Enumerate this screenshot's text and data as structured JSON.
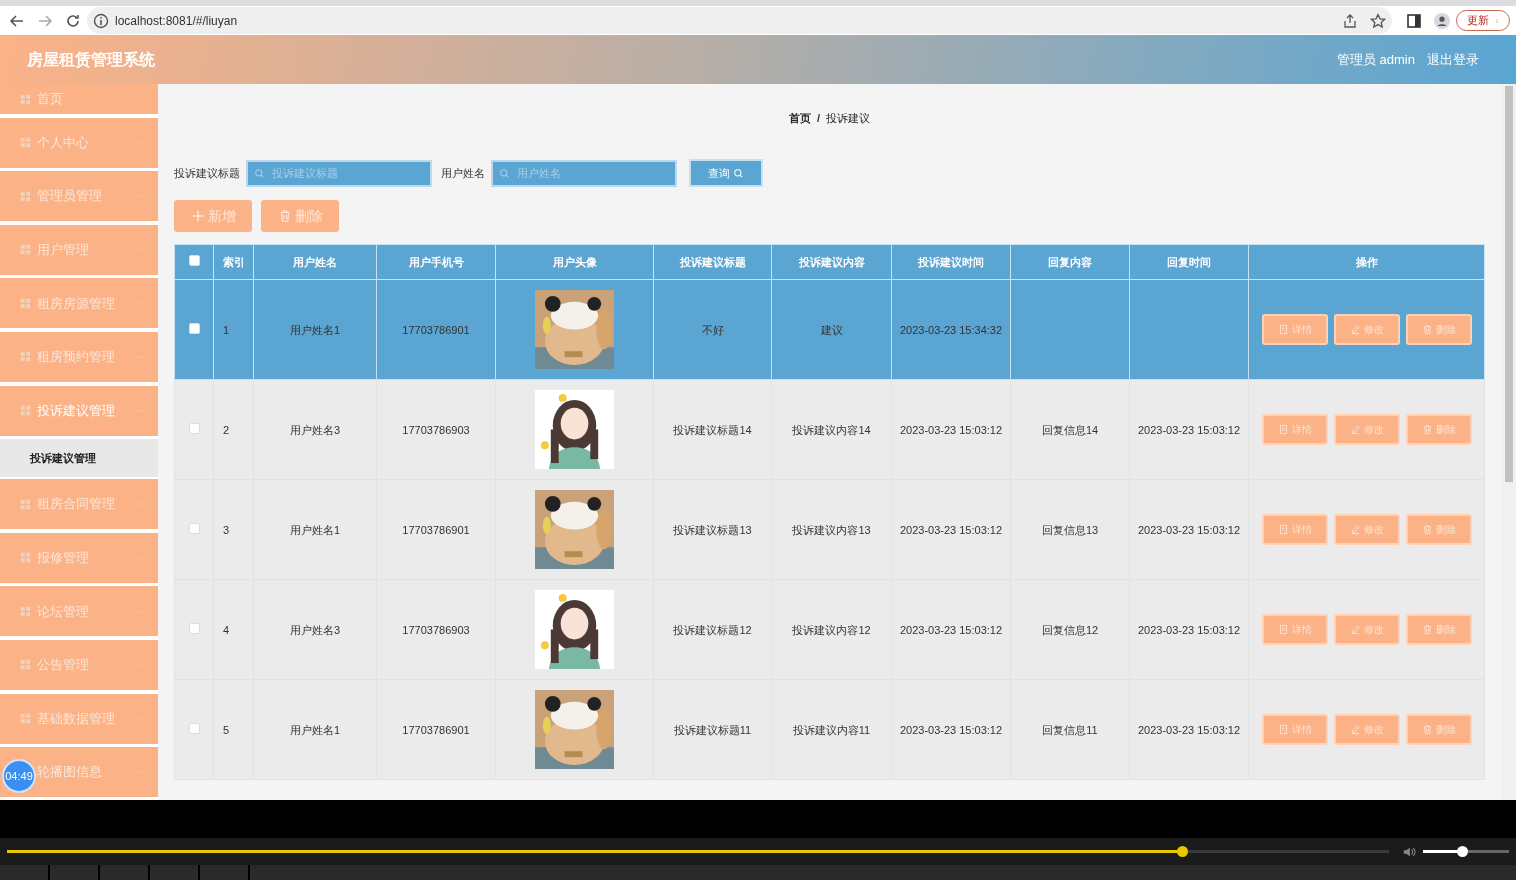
{
  "browser": {
    "url": "localhost:8081/#/liuyan",
    "update_button": "更新"
  },
  "header": {
    "title": "房屋租赁管理系统",
    "user": "管理员 admin",
    "logout": "退出登录"
  },
  "sidebar": {
    "items": [
      {
        "kind": "link",
        "label": "首页"
      },
      {
        "kind": "menu",
        "label": "个人中心",
        "expanded": false
      },
      {
        "kind": "menu",
        "label": "管理员管理",
        "expanded": false
      },
      {
        "kind": "menu",
        "label": "用户管理",
        "expanded": false
      },
      {
        "kind": "menu",
        "label": "租房房源管理",
        "expanded": false
      },
      {
        "kind": "menu",
        "label": "租房预约管理",
        "expanded": false
      },
      {
        "kind": "menu",
        "label": "投诉建议管理",
        "expanded": true,
        "children": [
          {
            "label": "投诉建议管理",
            "selected": true
          }
        ]
      },
      {
        "kind": "menu",
        "label": "租房合同管理",
        "expanded": false
      },
      {
        "kind": "menu",
        "label": "报修管理",
        "expanded": false
      },
      {
        "kind": "menu",
        "label": "论坛管理",
        "expanded": false
      },
      {
        "kind": "menu",
        "label": "公告管理",
        "expanded": false
      },
      {
        "kind": "menu",
        "label": "基础数据管理",
        "expanded": false
      },
      {
        "kind": "menu",
        "label": "轮播图信息",
        "expanded": false
      }
    ]
  },
  "breadcrumb": [
    "首页",
    "投诉建议"
  ],
  "breadcrumb_separator": "/",
  "search": {
    "fields": [
      {
        "label": "投诉建议标题",
        "placeholder": "投诉建议标题"
      },
      {
        "label": "用户姓名",
        "placeholder": "用户姓名"
      }
    ],
    "button": "查询"
  },
  "actions": [
    {
      "kind": "add",
      "label": "新增"
    },
    {
      "kind": "delete",
      "label": "删除"
    }
  ],
  "table": {
    "select_all_checked": false,
    "columns": [
      "索引",
      "用户姓名",
      "用户手机号",
      "用户头像",
      "投诉建议标题",
      "投诉建议内容",
      "投诉建议时间",
      "回复内容",
      "回复时间",
      "操作"
    ],
    "rows": [
      {
        "selected": true,
        "index": "1",
        "user_name": "用户姓名1",
        "phone": "17703786901",
        "title": "不好",
        "content": "建议",
        "time": "2023-03-23 15:34:32",
        "actions": [
          {
            "kind": "detail",
            "label": "详情"
          },
          {
            "kind": "edit",
            "label": "修改"
          },
          {
            "kind": "delete",
            "label": "删除"
          }
        ]
      },
      {
        "selected": false,
        "index": "2",
        "user_name": "用户姓名3",
        "phone": "17703786903",
        "title": "投诉建议标题14",
        "content": "投诉建议内容14",
        "time": "2023-03-23 15:03:12",
        "reply": "回复信息14",
        "reply_time": "2023-03-23 15:03:12",
        "actions": [
          {
            "kind": "detail",
            "label": "详情"
          },
          {
            "kind": "edit",
            "label": "修改"
          },
          {
            "kind": "delete",
            "label": "删除"
          }
        ]
      },
      {
        "selected": false,
        "index": "3",
        "user_name": "用户姓名1",
        "phone": "17703786901",
        "title": "投诉建议标题13",
        "content": "投诉建议内容13",
        "time": "2023-03-23 15:03:12",
        "reply": "回复信息13",
        "reply_time": "2023-03-23 15:03:12",
        "actions": [
          {
            "kind": "detail",
            "label": "详情"
          },
          {
            "kind": "edit",
            "label": "修改"
          },
          {
            "kind": "delete",
            "label": "删除"
          }
        ]
      },
      {
        "selected": false,
        "index": "4",
        "user_name": "用户姓名3",
        "phone": "17703786903",
        "title": "投诉建议标题12",
        "content": "投诉建议内容12",
        "time": "2023-03-23 15:03:12",
        "reply": "回复信息12",
        "reply_time": "2023-03-23 15:03:12",
        "actions": [
          {
            "kind": "detail",
            "label": "详情"
          },
          {
            "kind": "edit",
            "label": "修改"
          },
          {
            "kind": "delete",
            "label": "删除"
          }
        ]
      },
      {
        "selected": false,
        "index": "5",
        "user_name": "用户姓名1",
        "phone": "17703786901",
        "title": "投诉建议标题11",
        "content": "投诉建议内容11",
        "time": "2023-03-23 15:03:12",
        "reply": "回复信息11",
        "reply_time": "2023-03-23 15:03:12",
        "actions": [
          {
            "kind": "detail",
            "label": "详情"
          },
          {
            "kind": "edit",
            "label": "修改"
          },
          {
            "kind": "delete",
            "label": "删除"
          }
        ]
      }
    ]
  },
  "player": {
    "time_badge": "04:49",
    "progress": {
      "level": 0.85
    },
    "volume": {
      "level": 0.45
    }
  }
}
